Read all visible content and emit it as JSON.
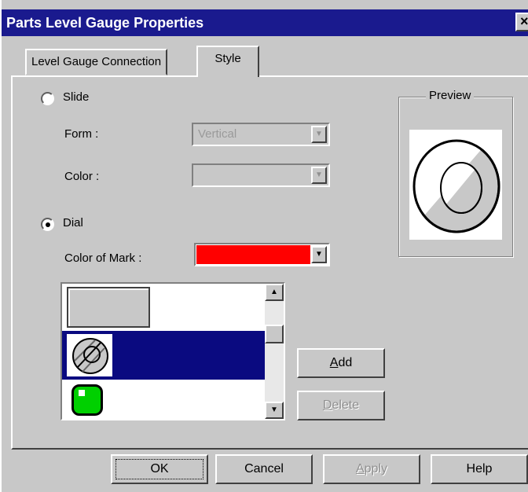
{
  "window": {
    "title": "Parts Level Gauge Properties",
    "close_label": "×"
  },
  "tabs": [
    {
      "label": "Level Gauge Connection",
      "active": false
    },
    {
      "label": "Style",
      "active": true
    }
  ],
  "slide": {
    "radio_label": "Slide",
    "selected": false,
    "form_label": "Form :",
    "form_value": "Vertical",
    "color_label": "Color :",
    "color_value": ""
  },
  "dial": {
    "radio_label": "Dial",
    "selected": true,
    "color_of_mark_label": "Color of Mark :",
    "color_of_mark_value": "#ff0000"
  },
  "style_list": {
    "items": [
      {
        "icon": "rectangle-style-icon",
        "selected": false
      },
      {
        "icon": "dial-gauge-style-icon",
        "selected": true
      },
      {
        "icon": "green-lamp-style-icon",
        "selected": false
      }
    ]
  },
  "buttons": {
    "add_prefix": "",
    "add_accel": "A",
    "add_rest": "dd",
    "delete_accel": "D",
    "delete_rest": "elete",
    "ok": "OK",
    "cancel": "Cancel",
    "apply_accel": "A",
    "apply_rest": "pply",
    "help": "Help"
  },
  "preview": {
    "label": "Preview"
  },
  "colors": {
    "title_bar": "#1a1a8e",
    "selection": "#0a0a80",
    "mark": "#ff0000",
    "face": "#c8c8c8"
  }
}
